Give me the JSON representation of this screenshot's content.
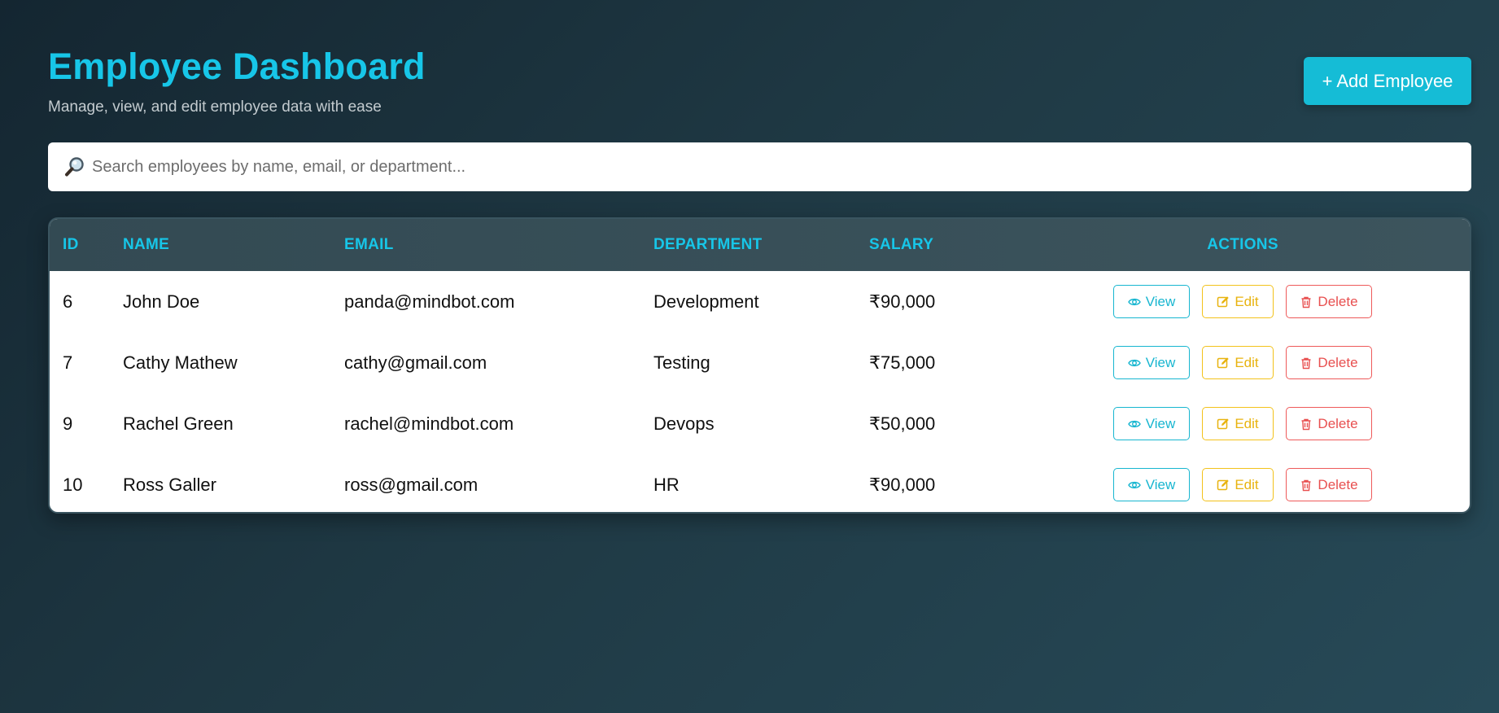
{
  "header": {
    "title": "Employee Dashboard",
    "subtitle": "Manage, view, and edit employee data with ease"
  },
  "toolbar": {
    "add_label": "+ Add Employee"
  },
  "search": {
    "placeholder": "Search employees by name, email, or department...",
    "value": ""
  },
  "table": {
    "columns": {
      "id": "ID",
      "name": "NAME",
      "email": "EMAIL",
      "department": "DEPARTMENT",
      "salary": "SALARY",
      "actions": "ACTIONS"
    },
    "rows": [
      {
        "id": "6",
        "name": "John Doe",
        "email": "panda@mindbot.com",
        "department": "Development",
        "salary": "₹90,000"
      },
      {
        "id": "7",
        "name": "Cathy Mathew",
        "email": "cathy@gmail.com",
        "department": "Testing",
        "salary": "₹75,000"
      },
      {
        "id": "9",
        "name": "Rachel Green",
        "email": "rachel@mindbot.com",
        "department": "Devops",
        "salary": "₹50,000"
      },
      {
        "id": "10",
        "name": "Ross Galler",
        "email": "ross@gmail.com",
        "department": "HR",
        "salary": "₹90,000"
      }
    ],
    "action_labels": {
      "view": "View",
      "edit": "Edit",
      "delete": "Delete"
    }
  },
  "icons": {
    "search": "search-icon",
    "view": "eye-icon",
    "edit": "edit-icon",
    "delete": "trash-icon"
  },
  "colors": {
    "accent": "#17c6e8",
    "primary_button": "#15bcd6",
    "view": "#17b6d0",
    "edit": "#f3c21b",
    "delete": "#ee5a5a"
  }
}
